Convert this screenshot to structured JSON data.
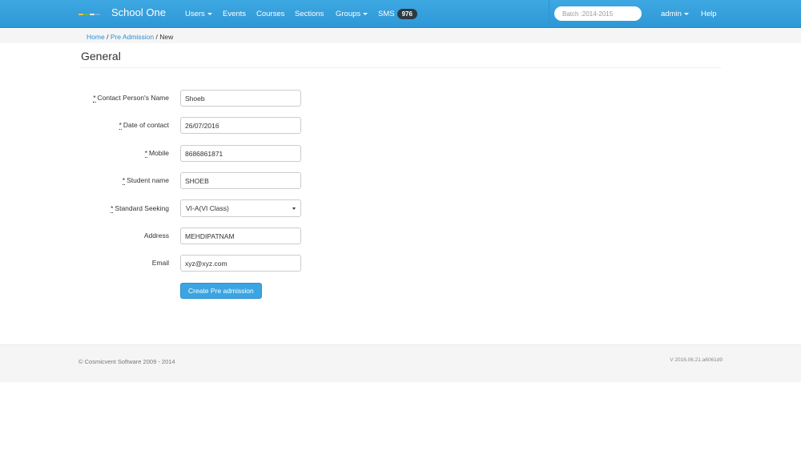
{
  "navbar": {
    "brand": "School One",
    "logo_colors": [
      "#f2c04c",
      "#5cb85c",
      "#e8e8e8",
      "#6ab0e0"
    ],
    "items": [
      {
        "label": "Users",
        "dropdown": true
      },
      {
        "label": "Events",
        "dropdown": false
      },
      {
        "label": "Courses",
        "dropdown": false
      },
      {
        "label": "Sections",
        "dropdown": false
      },
      {
        "label": "Groups",
        "dropdown": true
      },
      {
        "label": "SMS",
        "dropdown": false
      }
    ],
    "sms_badge": "976",
    "batch_placeholder": "Batch :2014-2015",
    "user_label": "admin",
    "help_label": "Help",
    "accent_color": "#38a2df"
  },
  "breadcrumb": {
    "home": "Home",
    "sep1": "/",
    "pre_admission": "Pre Admission",
    "sep2": "/",
    "current": "New"
  },
  "form": {
    "title": "General",
    "required_marker": "*",
    "fields": {
      "contact_name": {
        "label": "Contact Person's Name",
        "value": "Shoeb"
      },
      "date_of_contact": {
        "label": "Date of contact",
        "value": "26/07/2016"
      },
      "mobile": {
        "label": "Mobile",
        "value": "8686861871"
      },
      "student_name": {
        "label": "Student name",
        "value": "SHOEB"
      },
      "standard_seeking": {
        "label": "Standard Seeking",
        "value": "VI-A(VI Class)"
      },
      "address": {
        "label": "Address",
        "value": "MEHDIPATNAM"
      },
      "email": {
        "label": "Email",
        "value": "xyz@xyz.com"
      }
    },
    "submit_label": "Create Pre admission"
  },
  "footer": {
    "copyright": "© Cosmicvent Software 2009 - 2014",
    "version": "V 2016.06.21.a6061d9"
  }
}
